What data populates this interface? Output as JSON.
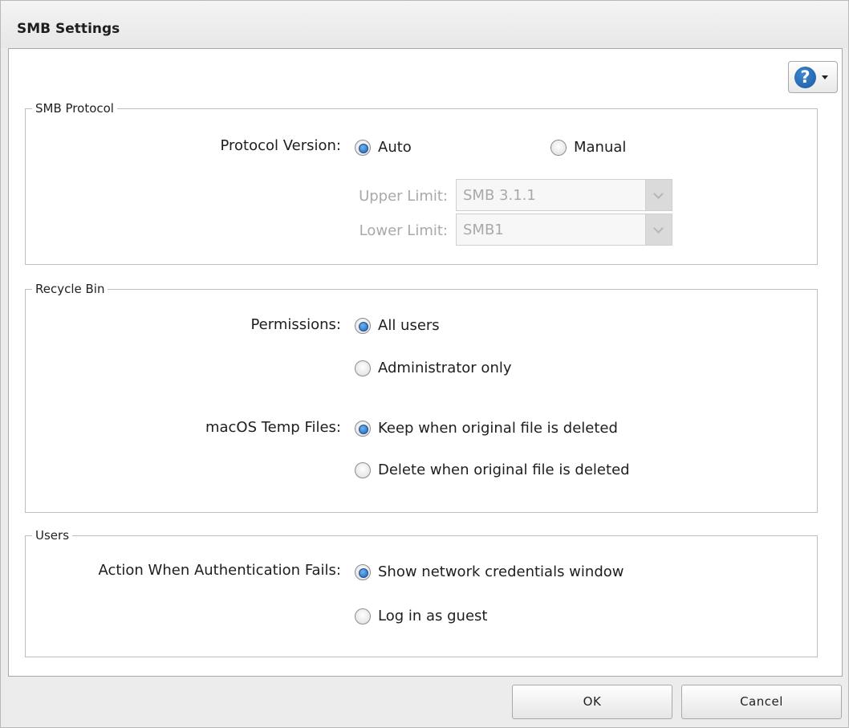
{
  "dialog": {
    "title": "SMB Settings"
  },
  "help": {
    "icon": "help-icon",
    "symbol": "?"
  },
  "smb_protocol": {
    "legend": "SMB Protocol",
    "protocol_version_label": "Protocol Version:",
    "options": {
      "auto": "Auto",
      "manual": "Manual"
    },
    "selected": "Auto",
    "upper_limit_label": "Upper Limit:",
    "upper_limit_value": "SMB 3.1.1",
    "lower_limit_label": "Lower Limit:",
    "lower_limit_value": "SMB1"
  },
  "recycle_bin": {
    "legend": "Recycle Bin",
    "permissions_label": "Permissions:",
    "permissions_options": {
      "all_users": "All users",
      "admin_only": "Administrator only"
    },
    "permissions_selected": "All users",
    "macos_label": "macOS Temp Files:",
    "macos_options": {
      "keep": "Keep when original file is deleted",
      "delete": "Delete when original file is deleted"
    },
    "macos_selected": "Keep when original file is deleted"
  },
  "users": {
    "legend": "Users",
    "auth_fail_label": "Action When Authentication Fails:",
    "auth_fail_options": {
      "show_window": "Show network credentials window",
      "guest": "Log in as guest"
    },
    "auth_fail_selected": "Show network credentials window"
  },
  "buttons": {
    "ok": "OK",
    "cancel": "Cancel"
  },
  "colors": {
    "radio_selected": "#1f63b7",
    "disabled_text": "#a9a9a9",
    "dialog_bg": "#ececec"
  }
}
